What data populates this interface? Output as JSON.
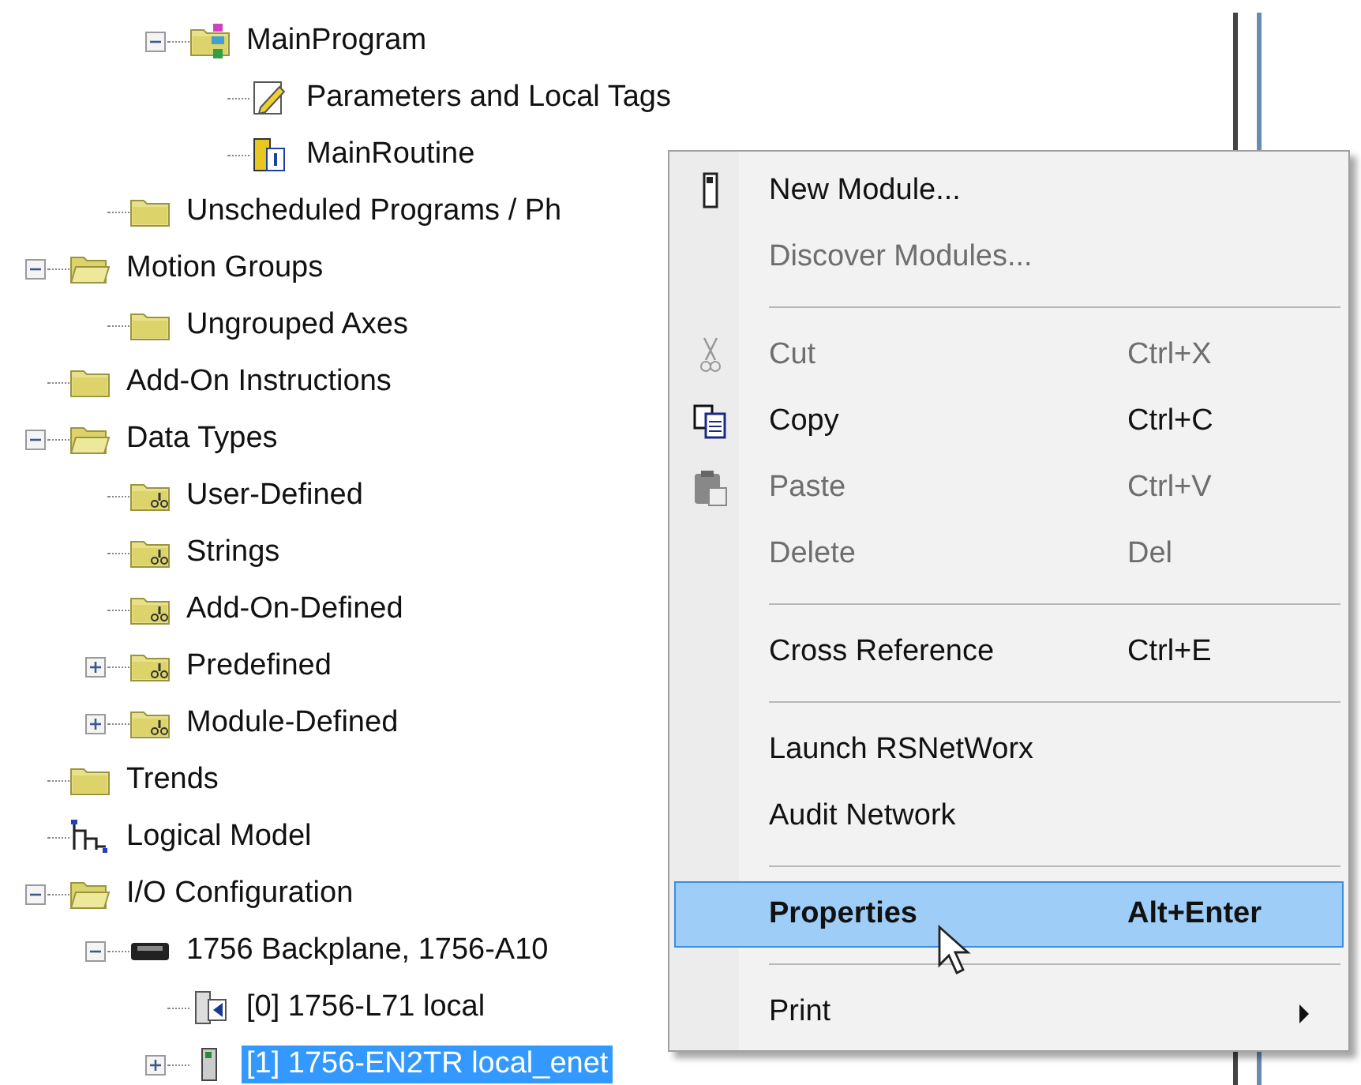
{
  "tree": [
    {
      "children": [
        {
          "children": [
            {
              "label": "MainProgram",
              "kind": "program",
              "expanded": true,
              "selected": false,
              "children": [
                {
                  "label": "Parameters and Local Tags",
                  "kind": "tags",
                  "selected": false
                },
                {
                  "label": "MainRoutine",
                  "kind": "routine",
                  "selected": false
                }
              ]
            }
          ]
        },
        {
          "label": "Unscheduled Programs / Ph",
          "kind": "folder",
          "selected": false
        }
      ]
    },
    {
      "label": "Motion Groups",
      "kind": "folder-open",
      "expanded": true,
      "selected": false,
      "children": [
        {
          "label": "Ungrouped Axes",
          "kind": "folder",
          "selected": false
        }
      ]
    },
    {
      "label": "Add-On Instructions",
      "kind": "folder",
      "selected": false
    },
    {
      "label": "Data Types",
      "kind": "folder-open",
      "expanded": true,
      "selected": false,
      "children": [
        {
          "label": "User-Defined",
          "kind": "datatype",
          "selected": false
        },
        {
          "label": "Strings",
          "kind": "datatype",
          "selected": false
        },
        {
          "label": "Add-On-Defined",
          "kind": "datatype",
          "selected": false
        },
        {
          "label": "Predefined",
          "kind": "datatype",
          "expanded": false,
          "selected": false
        },
        {
          "label": "Module-Defined",
          "kind": "datatype",
          "expanded": false,
          "selected": false
        }
      ]
    },
    {
      "label": "Trends",
      "kind": "folder",
      "selected": false
    },
    {
      "label": "Logical Model",
      "kind": "model",
      "selected": false
    },
    {
      "label": "I/O Configuration",
      "kind": "folder-open",
      "expanded": true,
      "selected": false,
      "children": [
        {
          "label": "1756 Backplane, 1756-A10",
          "kind": "backplane",
          "expanded": true,
          "selected": false,
          "children": [
            {
              "label": "[0] 1756-L71 local",
              "kind": "controller",
              "selected": false
            },
            {
              "label": "[1] 1756-EN2TR local_enet",
              "kind": "module",
              "expanded": false,
              "selected": true
            }
          ]
        }
      ]
    }
  ],
  "context_menu": {
    "items": [
      {
        "kind": "item",
        "label": "New Module...",
        "disabled": false,
        "highlighted": false
      },
      {
        "kind": "item",
        "label": "Discover Modules...",
        "disabled": true,
        "highlighted": false
      },
      {
        "kind": "separator"
      },
      {
        "kind": "item",
        "label": "Cut",
        "shortcut": "Ctrl+X",
        "disabled": true,
        "highlighted": false
      },
      {
        "kind": "item",
        "label": "Copy",
        "shortcut": "Ctrl+C",
        "disabled": false,
        "highlighted": false
      },
      {
        "kind": "item",
        "label": "Paste",
        "shortcut": "Ctrl+V",
        "disabled": true,
        "highlighted": false
      },
      {
        "kind": "item",
        "label": "Delete",
        "shortcut": "Del",
        "disabled": true,
        "highlighted": false
      },
      {
        "kind": "separator"
      },
      {
        "kind": "item",
        "label": "Cross Reference",
        "shortcut": "Ctrl+E",
        "disabled": false,
        "highlighted": false
      },
      {
        "kind": "separator"
      },
      {
        "kind": "item",
        "label": "Launch RSNetWorx",
        "disabled": false,
        "highlighted": false
      },
      {
        "kind": "item",
        "label": "Audit Network",
        "disabled": false,
        "highlighted": false
      },
      {
        "kind": "separator"
      },
      {
        "kind": "item",
        "label": "Properties",
        "shortcut": "Alt+Enter",
        "disabled": false,
        "highlighted": true
      },
      {
        "kind": "separator"
      },
      {
        "kind": "submenu",
        "label": "Print",
        "disabled": false,
        "highlighted": false
      }
    ]
  }
}
